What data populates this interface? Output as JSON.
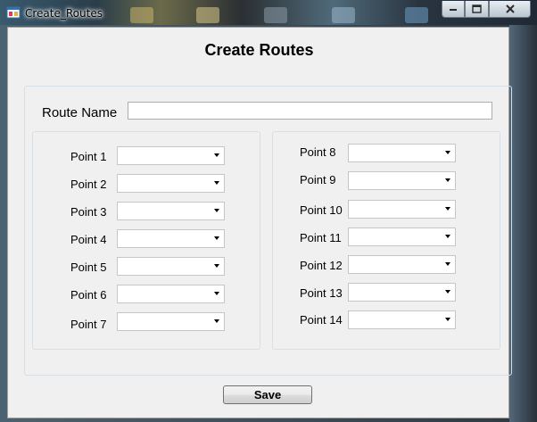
{
  "window": {
    "title": "Create_Routes"
  },
  "form": {
    "heading": "Create Routes",
    "route_name_label": "Route Name",
    "route_name_value": "",
    "save_label": "Save"
  },
  "points_left": [
    {
      "label": "Point 1",
      "value": ""
    },
    {
      "label": "Point 2",
      "value": ""
    },
    {
      "label": "Point 3",
      "value": ""
    },
    {
      "label": "Point 4",
      "value": ""
    },
    {
      "label": "Point 5",
      "value": ""
    },
    {
      "label": "Point 6",
      "value": ""
    },
    {
      "label": "Point 7",
      "value": ""
    }
  ],
  "points_right": [
    {
      "label": "Point 8",
      "value": ""
    },
    {
      "label": "Point 9",
      "value": ""
    },
    {
      "label": "Point 10",
      "value": ""
    },
    {
      "label": "Point 11",
      "value": ""
    },
    {
      "label": "Point 12",
      "value": ""
    },
    {
      "label": "Point 13",
      "value": ""
    },
    {
      "label": "Point 14",
      "value": ""
    }
  ],
  "icons": {
    "app": "app-window-icon",
    "minimize": "minimize-icon",
    "maximize": "maximize-icon",
    "close": "close-icon",
    "dropdown": "chevron-down-icon"
  },
  "colors": {
    "client_bg": "#f0f0f0",
    "group_border": "#d5dfe5"
  }
}
